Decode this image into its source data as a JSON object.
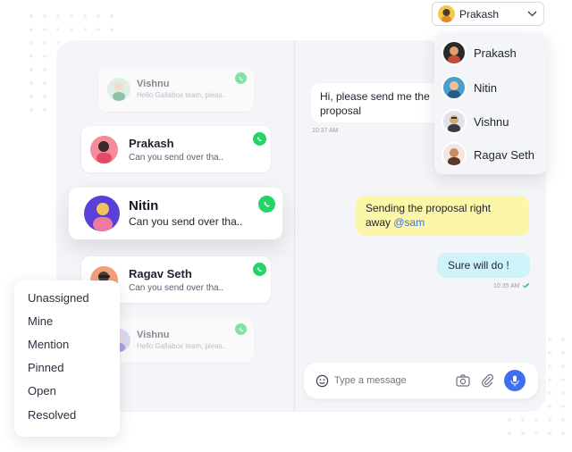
{
  "conversations": [
    {
      "name": "Vishnu",
      "preview": "Hello Gallabox team, pleas..",
      "channel_icon": "whatsapp-icon",
      "avatar_bg": "#c9ead7"
    },
    {
      "name": "Prakash",
      "preview": "Can you send over tha..",
      "channel_icon": "whatsapp-icon",
      "avatar_bg": "#f48c9b"
    },
    {
      "name": "Nitin",
      "preview": "Can you send over tha..",
      "channel_icon": "whatsapp-icon",
      "avatar_bg": "#5b3fd9"
    },
    {
      "name": "Ragav Seth",
      "preview": "Can you send over tha..",
      "channel_icon": "whatsapp-icon",
      "avatar_bg": "#f2a07a"
    },
    {
      "name": "Vishnu",
      "preview": "Hello Gallabox team, pleas..",
      "channel_icon": "whatsapp-icon",
      "avatar_bg": "#c5c3f0"
    }
  ],
  "chat": {
    "incoming": {
      "line1": "Hi, please send me the",
      "line2": "proposal",
      "time": "10:37 AM"
    },
    "outgoing_note": {
      "line1": "Sending the proposal right",
      "line2_text": "away ",
      "mention": "@sam"
    },
    "outgoing": {
      "text": "Sure will do !",
      "time": "10:35 AM"
    }
  },
  "composer": {
    "placeholder": "Type a message"
  },
  "user_select": {
    "selected": "Prakash"
  },
  "user_dropdown": {
    "options": [
      "Prakash",
      "Nitin",
      "Vishnu",
      "Ragav Seth"
    ]
  },
  "filters": [
    "Unassigned",
    "Mine",
    "Mention",
    "Pinned",
    "Open",
    "Resolved"
  ],
  "colors": {
    "whatsapp": "#25d366",
    "note_bg": "#fbf6a8",
    "outgoing_bg": "#cdf4f8",
    "mention": "#3b6fe0",
    "send_button": "#3f6ef0",
    "panel_bg": "#f4f5f8"
  }
}
